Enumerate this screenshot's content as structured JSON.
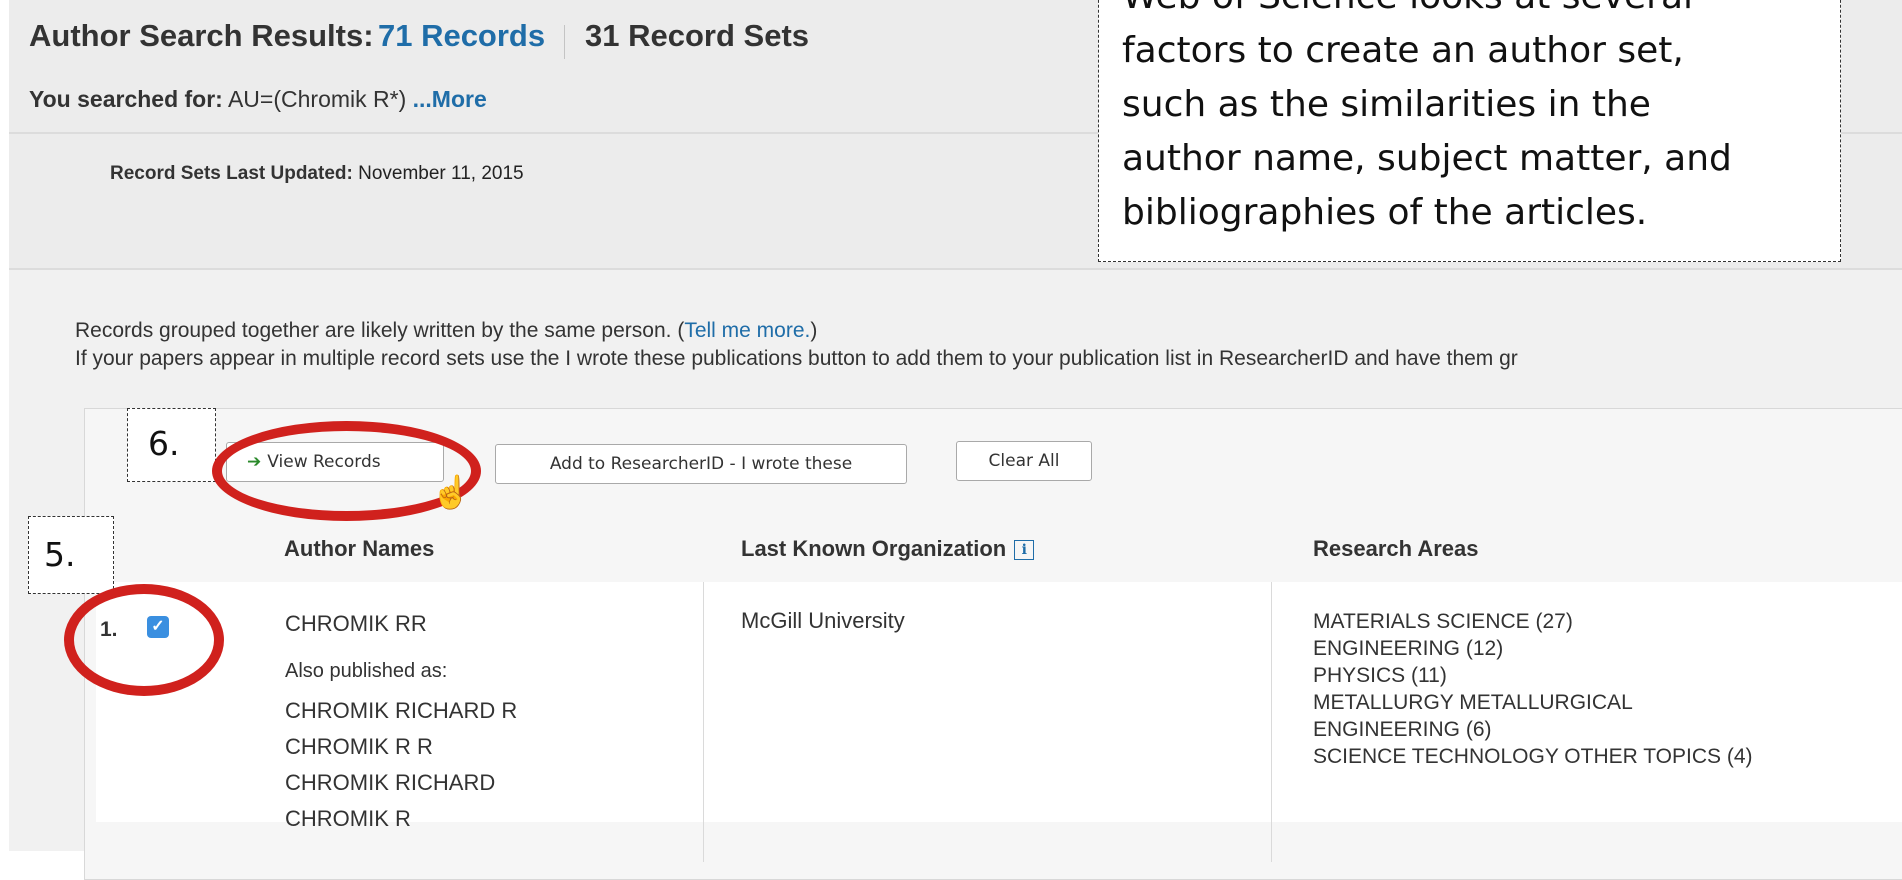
{
  "header": {
    "title_prefix": "Author Search Results:",
    "records_link": "71 Records",
    "record_sets": "31 Record Sets",
    "searched_label": "You searched for:",
    "searched_query": "AU=(Chromik R*)",
    "more_link": "...More"
  },
  "updated": {
    "label": "Record Sets Last Updated:",
    "date": "November 11, 2015"
  },
  "info": {
    "line1_prefix": "Records grouped together are likely written by the same person. (",
    "tell_me_more": "Tell me more.",
    "line1_suffix": ")",
    "line2": "If your papers appear in multiple record sets use the I wrote these publications button to add them to your publication list in ResearcherID and have them gr"
  },
  "toolbar": {
    "view_records": "View Records",
    "add_researcher": "Add to ResearcherID - I wrote these",
    "clear_all": "Clear All"
  },
  "columns": {
    "author_names": "Author Names",
    "last_org": "Last Known Organization",
    "research_areas": "Research Areas"
  },
  "row": {
    "number": "1.",
    "author": "CHROMIK RR",
    "also_label": "Also published as:",
    "also": [
      "CHROMIK RICHARD R",
      "CHROMIK R R",
      "CHROMIK RICHARD",
      "CHROMIK R"
    ],
    "organization": "McGill University",
    "areas": [
      "MATERIALS SCIENCE (27)",
      "ENGINEERING (12)",
      "PHYSICS (11)",
      "METALLURGY METALLURGICAL",
      "ENGINEERING (6)",
      "SCIENCE TECHNOLOGY OTHER TOPICS (4)"
    ],
    "checked": true
  },
  "annotations": {
    "callout_lines": [
      "Web of Science looks at several",
      "factors to create an author set,",
      "such as the similarities in the",
      "author name, subject matter, and",
      "bibliographies of the articles."
    ],
    "step6": "6.",
    "step5": "5.",
    "highlight_color": "#d0211d"
  },
  "icons": {
    "view_arrow": "arrow-right-icon",
    "info": "info-icon",
    "checkbox": "checkbox-checked-icon",
    "cursor": "hand-pointer-icon",
    "collapse": "collapse-arrow-icon"
  },
  "colors": {
    "link": "#1f6da8",
    "checkbox": "#3a8fe0",
    "arrow": "#2b8a2b"
  }
}
